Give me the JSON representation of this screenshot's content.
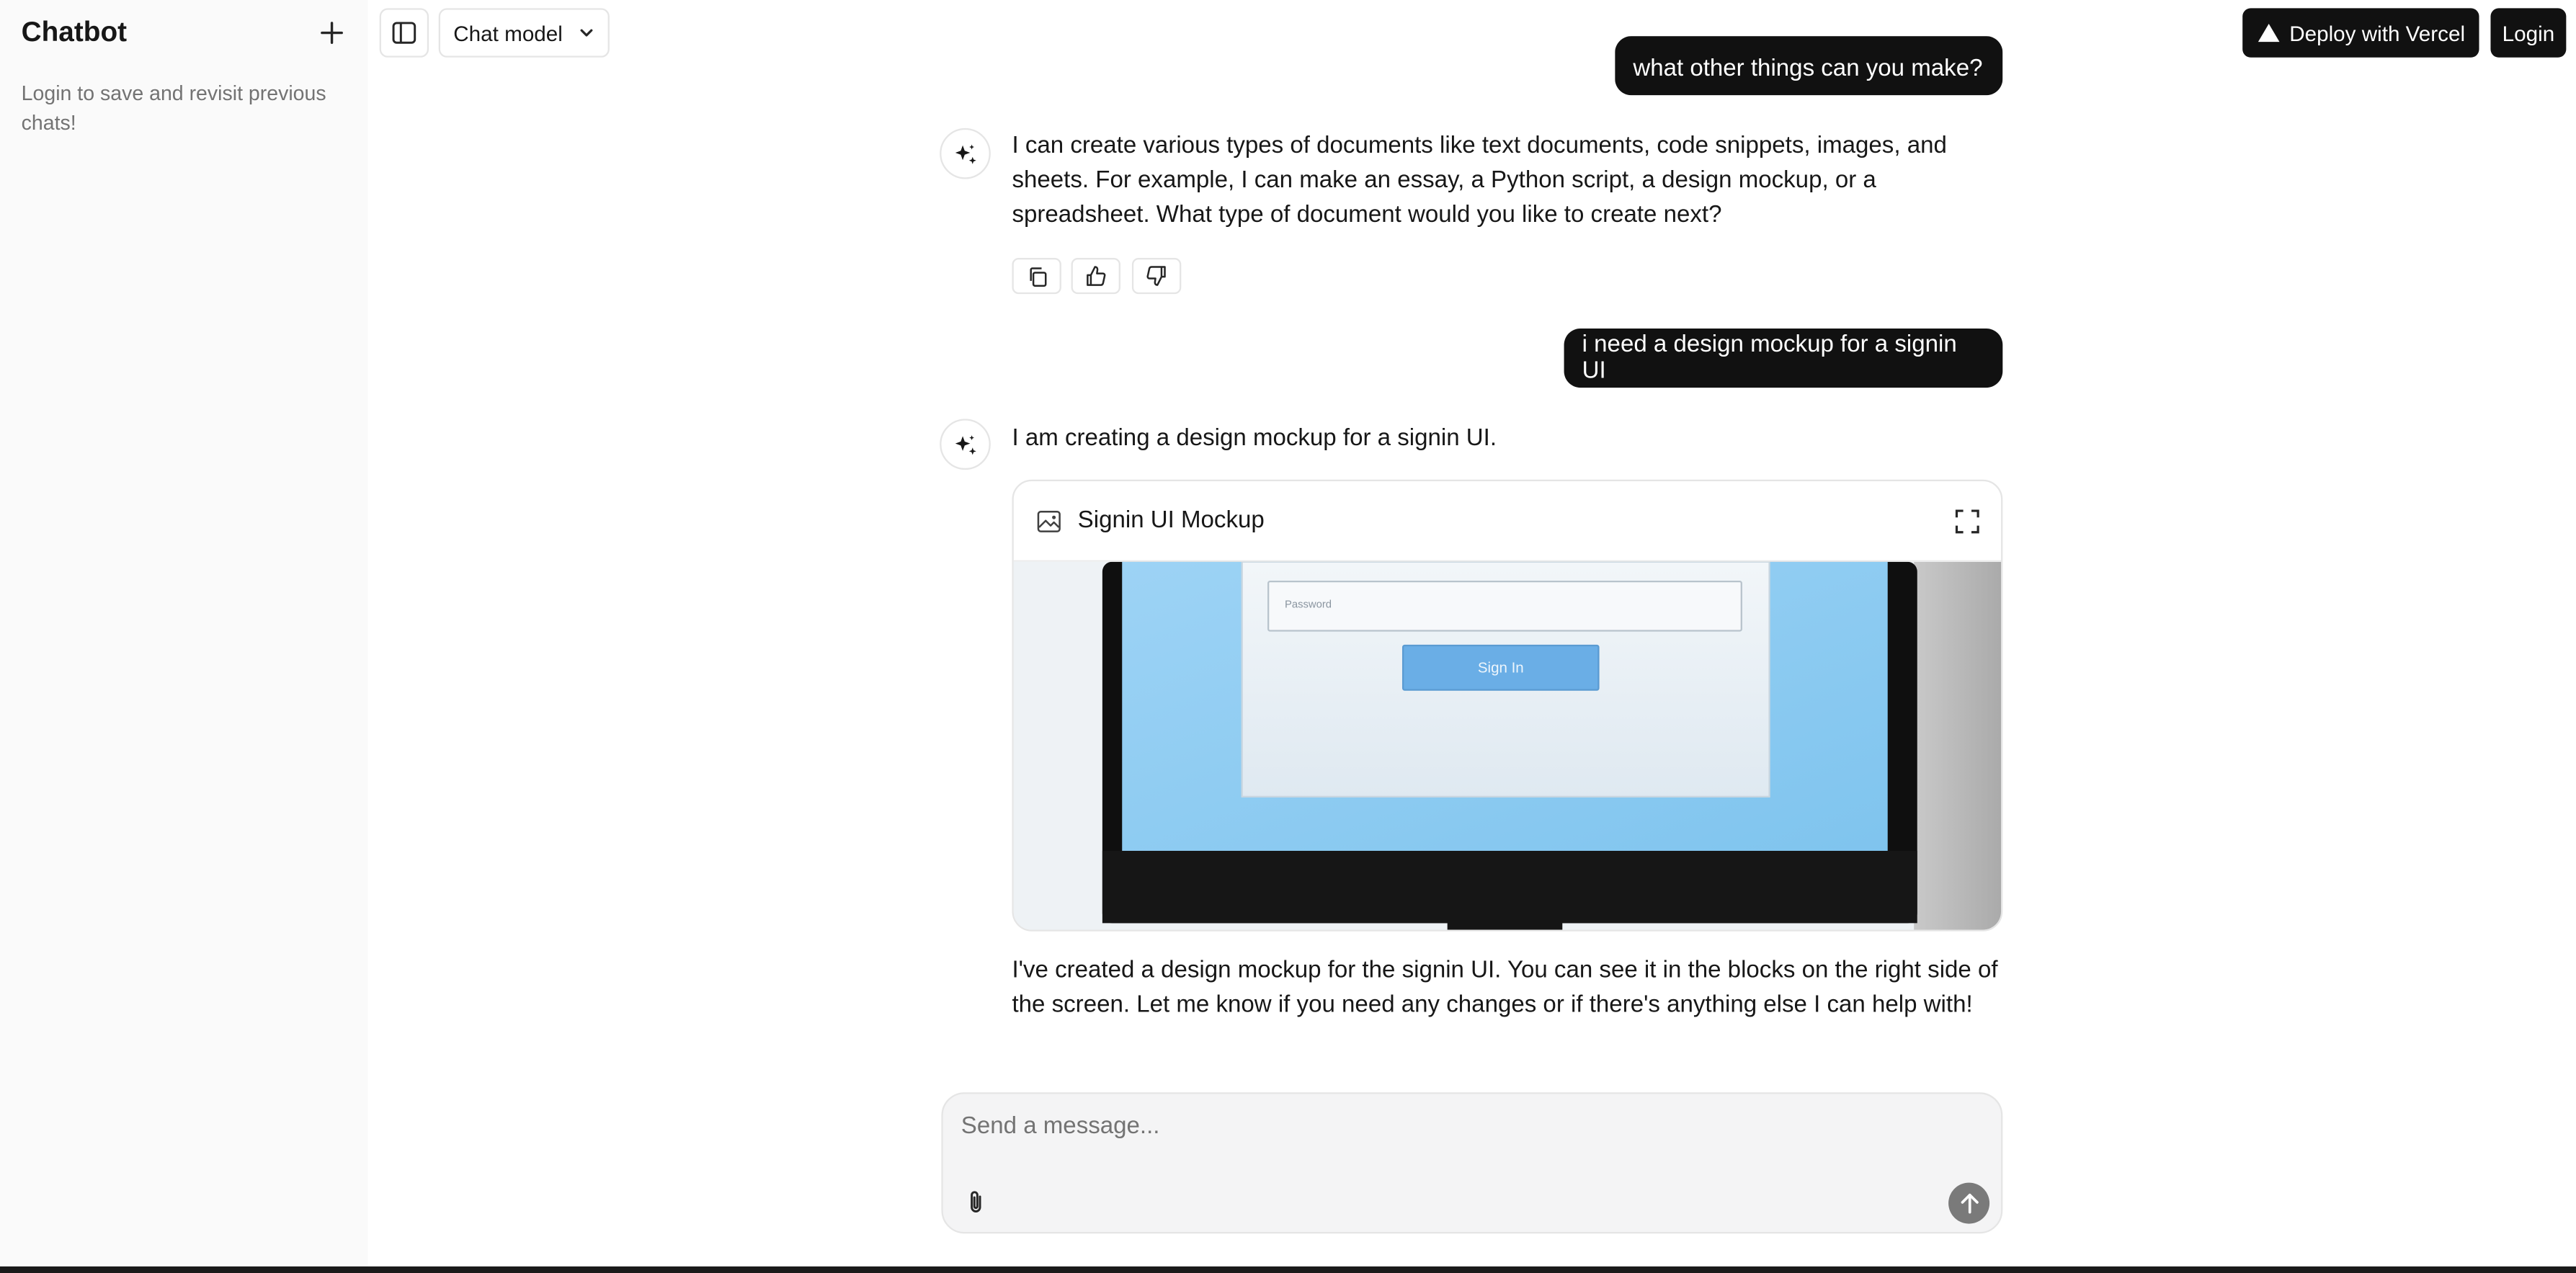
{
  "sidebar": {
    "title": "Chatbot",
    "new_chat_icon": "plus-icon",
    "note": "Login to save and revisit previous chats!"
  },
  "topbar": {
    "toggle_icon": "sidebar-toggle-icon",
    "model_label": "Chat model",
    "model_icon": "chevron-down-icon",
    "deploy_label": "Deploy with Vercel",
    "deploy_icon": "vercel-triangle-icon",
    "login_label": "Login"
  },
  "messages": {
    "user_1": "what other things can you make?",
    "assistant_1": "I can create various types of documents like text documents, code snippets, images, and sheets. For example, I can make an essay, a Python script, a design mockup, or a spreadsheet. What type of document would you like to create next?",
    "actions": [
      "copy-icon",
      "thumbs-up-icon",
      "thumbs-down-icon"
    ],
    "user_2": "i need a design mockup for a signin UI",
    "assistant_2": "I am creating a design mockup for a signin UI.",
    "document": {
      "title": "Signin UI Mockup",
      "type_icon": "image-icon",
      "expand_icon": "fullscreen-icon",
      "image": {
        "field_placeholder": "Password",
        "button_label": "Sign In"
      }
    },
    "assistant_3": "I've created a design mockup for the signin UI. You can see it in the blocks on the right side of the screen. Let me know if you need any changes or if there's anything else I can help with!"
  },
  "composer": {
    "placeholder": "Send a message...",
    "attach_icon": "paperclip-icon",
    "send_icon": "arrow-up-icon"
  },
  "colors": {
    "sidebar_bg": "#fafafa",
    "user_bubble": "#111111",
    "send_button": "#7a7a7a",
    "mockup_screen": "#8ccdf3"
  }
}
